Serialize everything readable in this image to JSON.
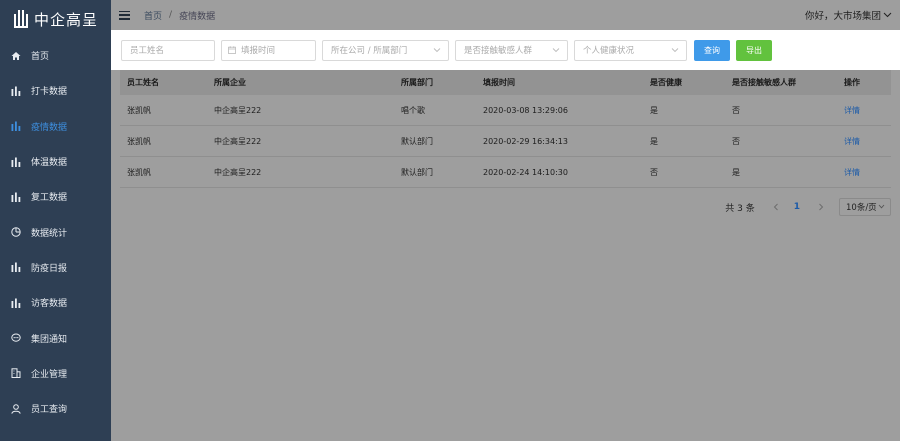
{
  "brand": {
    "name": "中企高呈"
  },
  "sidebar": {
    "items": [
      {
        "label": "首页",
        "icon": "home-icon"
      },
      {
        "label": "打卡数据",
        "icon": "bar-chart-icon"
      },
      {
        "label": "疫情数据",
        "icon": "bar-chart-icon",
        "active": true
      },
      {
        "label": "体温数据",
        "icon": "bar-chart-icon"
      },
      {
        "label": "复工数据",
        "icon": "bar-chart-icon"
      },
      {
        "label": "数据统计",
        "icon": "pie-chart-icon"
      },
      {
        "label": "防疫日报",
        "icon": "bar-chart-icon"
      },
      {
        "label": "访客数据",
        "icon": "bar-chart-icon"
      },
      {
        "label": "集团通知",
        "icon": "chat-bubble-icon"
      },
      {
        "label": "企业管理",
        "icon": "building-icon"
      },
      {
        "label": "员工查询",
        "icon": "user-icon"
      }
    ]
  },
  "header": {
    "breadcrumb_home": "首页",
    "breadcrumb_sep": "/",
    "breadcrumb_current": "疫情数据",
    "user_greeting": "你好，大市场集团"
  },
  "filters": {
    "name_placeholder": "员工姓名",
    "date_placeholder": "填报时间",
    "org_placeholder": "所在公司 / 所属部门",
    "contact_placeholder": "是否接触敏感人群",
    "health_placeholder": "个人健康状况",
    "query_label": "查询",
    "export_label": "导出"
  },
  "table": {
    "headers": [
      "员工姓名",
      "所属企业",
      "所属部门",
      "填报时间",
      "是否健康",
      "是否接触敏感人群",
      "操作"
    ],
    "rows": [
      [
        "张凯帆",
        "中企高呈222",
        "唱个歌",
        "2020-03-08 13:29:06",
        "是",
        "否",
        "详情"
      ],
      [
        "张凯帆",
        "中企高呈222",
        "默认部门",
        "2020-02-29 16:34:13",
        "是",
        "否",
        "详情"
      ],
      [
        "张凯帆",
        "中企高呈222",
        "默认部门",
        "2020-02-24 14:10:30",
        "否",
        "是",
        "详情"
      ]
    ]
  },
  "pagination": {
    "total": "共 3 条",
    "current_page": "1",
    "page_size": "10条/页"
  },
  "colors": {
    "sidebar_bg": "#2e3f54",
    "active": "#3d8fe0",
    "query_button": "#3f9ae9",
    "export_button": "#62c23e",
    "link": "#1b5aa8"
  }
}
